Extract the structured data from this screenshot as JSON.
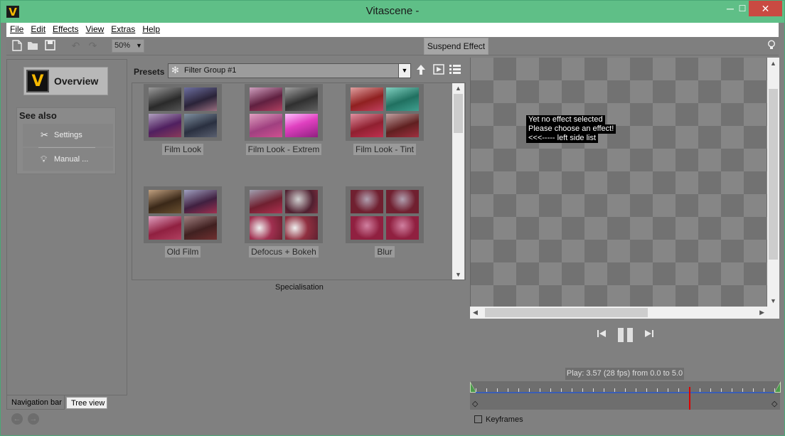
{
  "window": {
    "title": "Vitascene -",
    "app_icon_letter": "V",
    "minimize_glyph": "─",
    "maximize_glyph": "☐",
    "close_glyph": "✕"
  },
  "menu": [
    "File",
    "Edit",
    "Effects",
    "View",
    "Extras",
    "Help"
  ],
  "toolbar": {
    "zoom_value": "50%",
    "suspend_label": "Suspend Effect",
    "icons": [
      "new-file-icon",
      "open-folder-icon",
      "save-icon",
      "undo-icon",
      "redo-icon",
      "lightbulb-icon"
    ]
  },
  "left_panel": {
    "overview_label": "Overview",
    "see_also_title": "See also",
    "see_also_items": [
      {
        "label": "Settings",
        "icon": "tools-icon"
      },
      {
        "label": "Manual ...",
        "icon": "lightbulb-icon"
      }
    ],
    "tabs": {
      "active": "Navigation bar",
      "inactive": "Tree view"
    }
  },
  "presets": {
    "label": "Presets",
    "group": "Filter Group #1",
    "items": [
      "Film Look",
      "Film Look - Extrem",
      "Film Look - Tint",
      "Old Film",
      "Defocus + Bokeh",
      "Blur"
    ],
    "section_label": "Specialisation"
  },
  "viewer": {
    "message_lines": [
      "Yet no effect selected",
      "Please choose an effect!",
      "<<<----- left side list"
    ]
  },
  "playback": {
    "info": "Play: 3.57 (28 fps) from 0.0 to 5.0",
    "cursor_fraction": 0.714
  },
  "keyframes_label": "Keyframes",
  "colors": {
    "title_bar": "#5fbf87",
    "panel": "#808080",
    "close_button": "#c94a42",
    "timeline_bar": "#3a5db5",
    "cursor": "#dd0000"
  }
}
